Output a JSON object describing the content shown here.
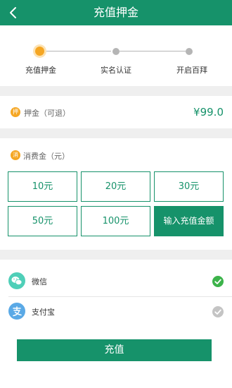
{
  "header": {
    "title": "充值押金",
    "back_icon": "chevron-left-icon"
  },
  "steps": [
    {
      "label": "充值押金",
      "active": true
    },
    {
      "label": "实名认证",
      "active": false
    },
    {
      "label": "开启百拜",
      "active": false
    }
  ],
  "deposit": {
    "badge": "押",
    "label": "押金（可退）",
    "amount": "¥99.0"
  },
  "consume": {
    "badge": "消",
    "label": "消费金（元）",
    "options": [
      "10元",
      "20元",
      "30元",
      "50元",
      "100元"
    ],
    "custom_label": "输入充值金额"
  },
  "payment": {
    "methods": [
      {
        "label": "微信",
        "icon": "wechat-icon",
        "selected": true
      },
      {
        "label": "支付宝",
        "icon": "alipay-icon",
        "selected": false
      }
    ]
  },
  "submit_label": "充值",
  "colors": {
    "primary": "#16926a",
    "accent": "#f5a623",
    "background": "#efefef",
    "wechat": "#4fcfb8",
    "alipay": "#5aa9e6",
    "check_on": "#3cb34a",
    "check_off": "#c4c4c4"
  }
}
